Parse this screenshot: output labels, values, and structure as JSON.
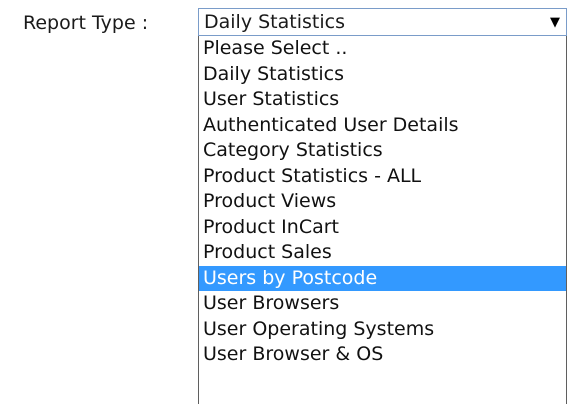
{
  "form": {
    "label": "Report Type :",
    "selected_value": "Daily Statistics",
    "arrow_icon": "dropdown-arrow-icon"
  },
  "dropdown": {
    "highlighted_index": 9,
    "highlight_color": "#3399ff",
    "options": [
      "Please Select ..",
      "Daily Statistics",
      "User Statistics",
      "Authenticated User Details",
      "Category Statistics",
      "Product Statistics - ALL",
      "Product Views",
      "Product InCart",
      "Product Sales",
      "Users by Postcode",
      "User Browsers",
      "User Operating Systems",
      "User Browser & OS"
    ]
  }
}
